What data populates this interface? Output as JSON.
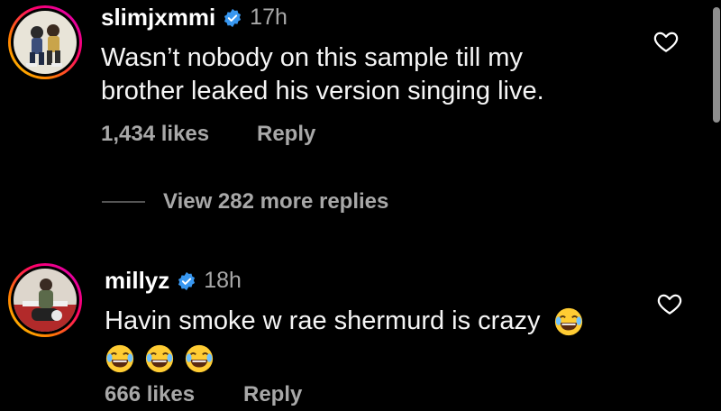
{
  "comments": [
    {
      "username": "slimjxmmi",
      "time": "17h",
      "text_lines": [
        "Wasn’t nobody on this sample till my",
        "brother leaked his version singing live."
      ],
      "likes": "1,434 likes",
      "reply_label": "Reply"
    },
    {
      "username": "millyz",
      "time": "18h",
      "text_line1": "Havin smoke w rae shermurd is crazy",
      "likes": "666 likes",
      "reply_label": "Reply"
    }
  ],
  "view_replies": "View 282 more replies",
  "colors": {
    "muted": "#a8a8a8",
    "verified": "#3897f0",
    "ring_start": "#d300c5",
    "ring_end": "#ffd600"
  },
  "icons": [
    "verified-badge-icon",
    "heart-icon",
    "laughing-emoji-icon"
  ]
}
